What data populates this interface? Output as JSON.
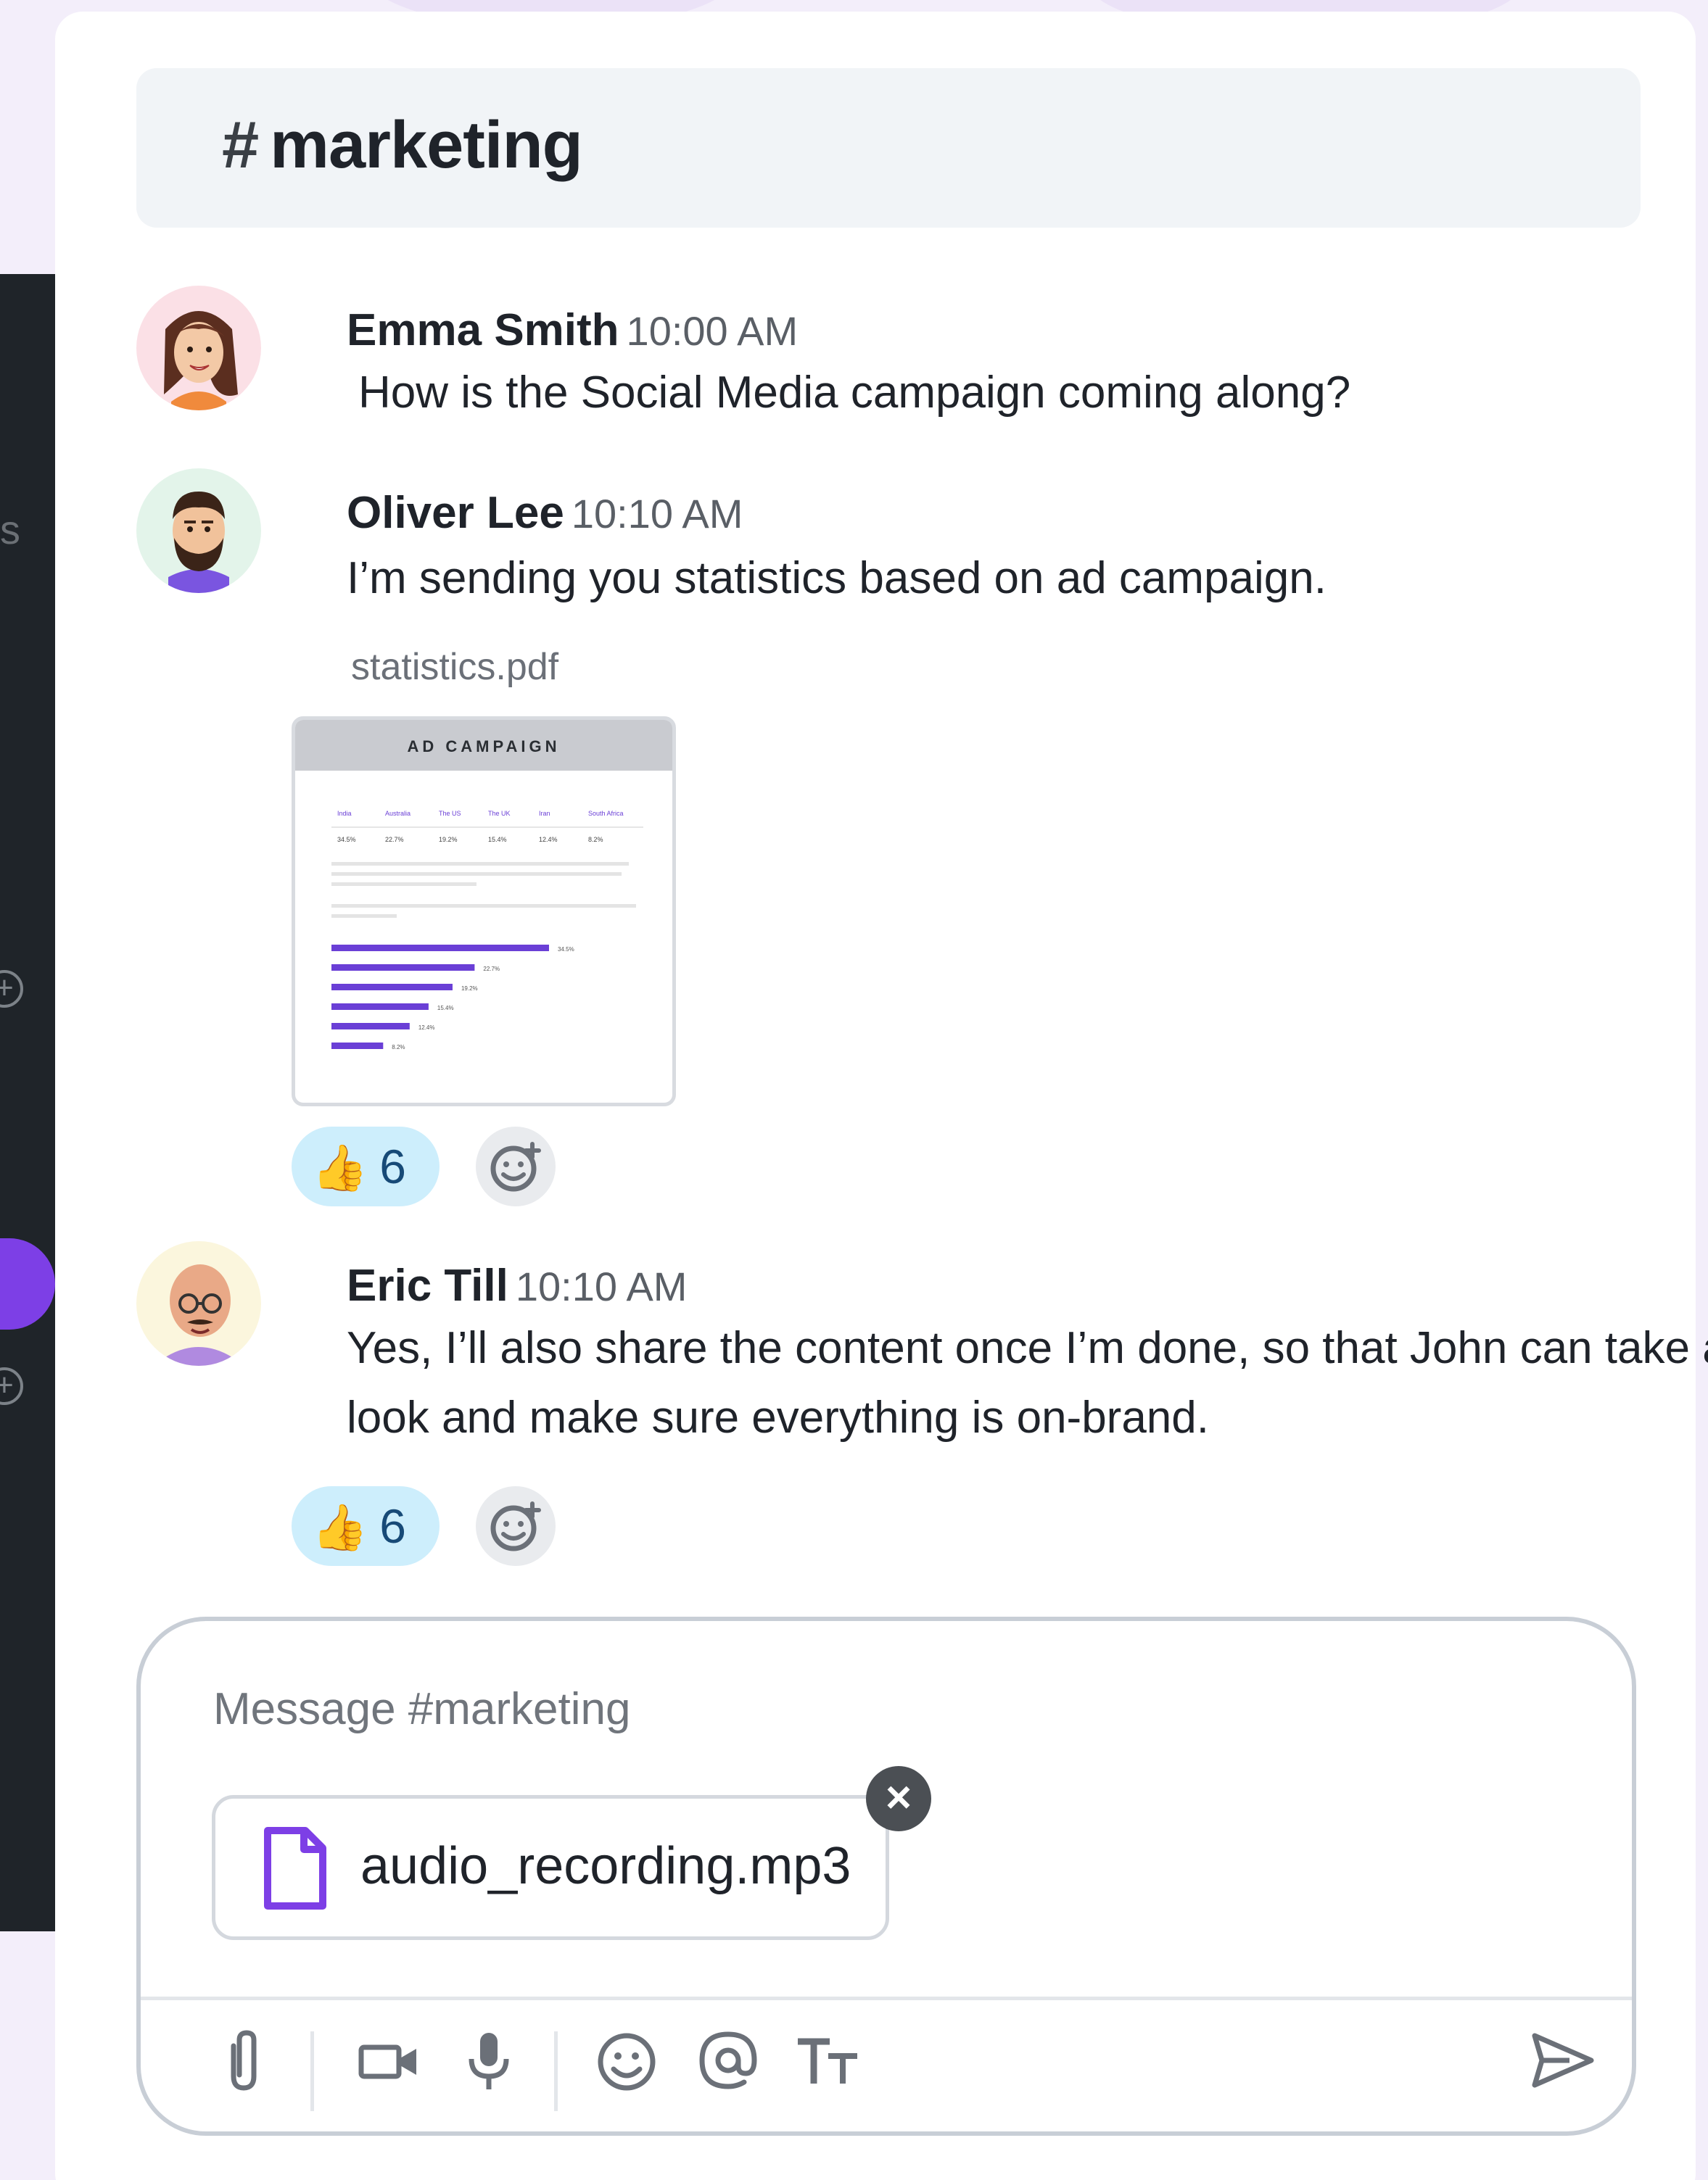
{
  "channel": {
    "hash": "#",
    "name": "marketing"
  },
  "sidebar": {
    "partial_text": "s"
  },
  "messages": [
    {
      "author": "Emma Smith",
      "time": "10:00 AM",
      "text": "How is the Social Media campaign coming along?",
      "avatar": "woman-avatar"
    },
    {
      "author": "Oliver Lee",
      "time": "10:10 AM",
      "text": "I’m sending you statistics based on ad campaign.",
      "avatar": "bearded-man-avatar",
      "attachment": {
        "file_name": "statistics.pdf",
        "preview_title": "AD CAMPAIGN",
        "columns": [
          "India",
          "Australia",
          "The US",
          "The UK",
          "Iran",
          "South Africa"
        ],
        "values": [
          "34.5%",
          "22.7%",
          "19.2%",
          "15.4%",
          "12.4%",
          "8.2%"
        ]
      },
      "reaction": {
        "emoji": "👍",
        "count": "6"
      }
    },
    {
      "author": "Eric Till",
      "time": "10:10 AM",
      "text": "Yes, I’ll also share the content once I’m done, so that John can take a look and make sure everything is on-brand.",
      "avatar": "bald-man-avatar",
      "reaction": {
        "emoji": "👍",
        "count": "6"
      }
    }
  ],
  "composer": {
    "placeholder": "Message #marketing",
    "attachment_name": "audio_recording.mp3",
    "tools": [
      "paperclip-icon",
      "video-camera-icon",
      "microphone-icon",
      "smiley-icon",
      "at-sign-icon",
      "text-format-icon",
      "send-icon"
    ]
  },
  "colors": {
    "accent": "#7d3fe6",
    "reaction_bg": "#cdeefc",
    "sidebar_bg": "#1f2429"
  }
}
